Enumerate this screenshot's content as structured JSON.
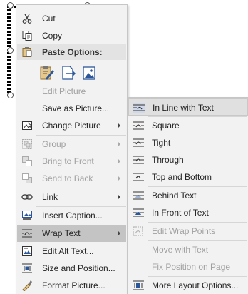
{
  "context_menu": {
    "items": [
      {
        "label": "Cut",
        "icon": "scissors-icon",
        "enabled": true
      },
      {
        "label": "Copy",
        "icon": "copy-icon",
        "enabled": true
      },
      {
        "label": "Edit Picture",
        "enabled": false
      },
      {
        "label": "Save as Picture...",
        "enabled": true
      },
      {
        "label": "Change Picture",
        "icon": "change-picture-icon",
        "enabled": true,
        "submenu": true
      },
      {
        "label": "Group",
        "icon": "group-icon",
        "enabled": false,
        "submenu": true
      },
      {
        "label": "Bring to Front",
        "icon": "bring-to-front-icon",
        "enabled": false,
        "submenu": true
      },
      {
        "label": "Send to Back",
        "icon": "send-to-back-icon",
        "enabled": false,
        "submenu": true
      },
      {
        "label": "Link",
        "icon": "link-icon",
        "enabled": true,
        "submenu": true
      },
      {
        "label": "Insert Caption...",
        "icon": "insert-caption-icon",
        "enabled": true
      },
      {
        "label": "Wrap Text",
        "icon": "wrap-text-icon",
        "enabled": true,
        "submenu": true,
        "highlighted": true
      },
      {
        "label": "Edit Alt Text...",
        "icon": "alt-text-icon",
        "enabled": true
      },
      {
        "label": "Size and Position...",
        "icon": "size-position-icon",
        "enabled": true
      },
      {
        "label": "Format Picture...",
        "icon": "format-picture-icon",
        "enabled": true
      }
    ],
    "paste_options": {
      "label": "Paste Options:",
      "buttons": [
        "paste-keep-formatting-icon",
        "paste-link-icon",
        "paste-picture-icon"
      ]
    }
  },
  "wrap_submenu": {
    "items": [
      {
        "label": "In Line with Text",
        "enabled": true,
        "selected": true
      },
      {
        "label": "Square",
        "enabled": true
      },
      {
        "label": "Tight",
        "enabled": true
      },
      {
        "label": "Through",
        "enabled": true
      },
      {
        "label": "Top and Bottom",
        "enabled": true
      },
      {
        "label": "Behind Text",
        "enabled": true
      },
      {
        "label": "In Front of Text",
        "enabled": true
      },
      {
        "label": "Edit Wrap Points",
        "enabled": false
      },
      {
        "label": "Move with Text",
        "enabled": false
      },
      {
        "label": "Fix Position on Page",
        "enabled": false
      },
      {
        "label": "More Layout Options...",
        "enabled": true
      }
    ]
  },
  "colors": {
    "accent": "#2b579a",
    "highlight": "#c4c4c4",
    "disabled_text": "#a0a0a0"
  }
}
